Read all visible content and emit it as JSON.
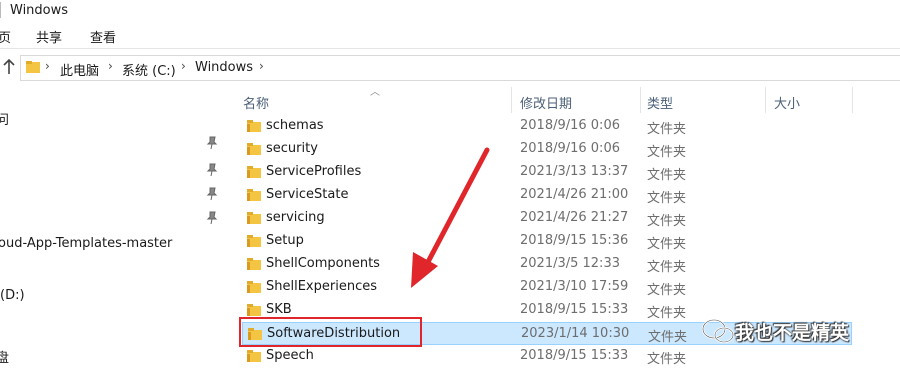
{
  "window": {
    "title": "Windows"
  },
  "ribbon": {
    "tabs": [
      "页",
      "共享",
      "查看"
    ]
  },
  "address": {
    "crumbs": [
      "此电脑",
      "系统 (C:)",
      "Windows"
    ]
  },
  "nav": {
    "items": [
      {
        "label": "问"
      },
      {
        "label": "oud-App-Templates-master"
      },
      {
        "label": "(D:)"
      },
      {
        "label": "盘"
      }
    ]
  },
  "columns": {
    "name": "名称",
    "modified": "修改日期",
    "type": "类型",
    "size": "大小"
  },
  "files": [
    {
      "name": "schemas",
      "modified": "2018/9/16 0:06",
      "type": "文件夹"
    },
    {
      "name": "security",
      "modified": "2018/9/16 0:06",
      "type": "文件夹"
    },
    {
      "name": "ServiceProfiles",
      "modified": "2021/3/13 13:37",
      "type": "文件夹"
    },
    {
      "name": "ServiceState",
      "modified": "2021/4/26 21:00",
      "type": "文件夹"
    },
    {
      "name": "servicing",
      "modified": "2021/4/26 21:27",
      "type": "文件夹"
    },
    {
      "name": "Setup",
      "modified": "2018/9/15 15:36",
      "type": "文件夹"
    },
    {
      "name": "ShellComponents",
      "modified": "2021/3/5 12:33",
      "type": "文件夹"
    },
    {
      "name": "ShellExperiences",
      "modified": "2021/3/10 17:59",
      "type": "文件夹"
    },
    {
      "name": "SKB",
      "modified": "2018/9/15 15:33",
      "type": "文件夹"
    },
    {
      "name": "SoftwareDistribution",
      "modified": "2023/1/14 10:30",
      "type": "文件夹"
    },
    {
      "name": "Speech",
      "modified": "2018/9/15 15:33",
      "type": "文件夹"
    }
  ],
  "selected_file": "SoftwareDistribution",
  "watermark": {
    "text": "我也不是精英"
  },
  "colors": {
    "selection": "#cce8ff",
    "highlight_box": "#e0262a",
    "folder": "#f4c542"
  }
}
